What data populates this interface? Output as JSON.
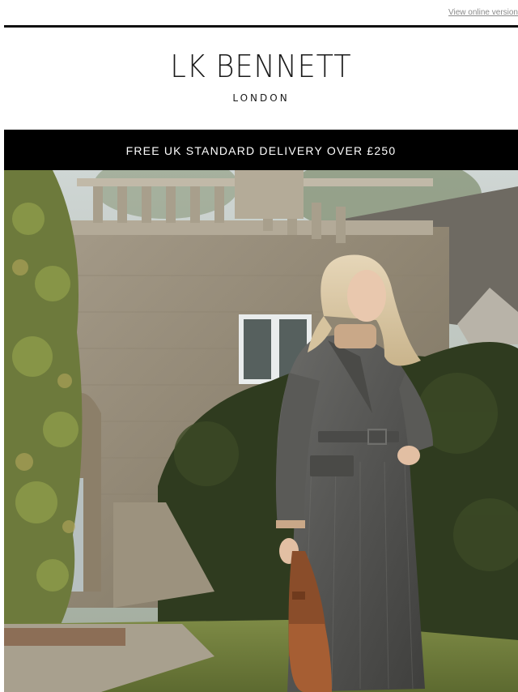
{
  "header": {
    "view_online_label": "View online version"
  },
  "brand": {
    "logo_text": "LK BENNETT",
    "logo_subtext": "LONDON"
  },
  "banner": {
    "delivery_text": "FREE UK STANDARD DELIVERY OVER £250"
  },
  "colors": {
    "banner_bg": "#000000",
    "banner_text": "#ffffff",
    "rule": "#111111",
    "link": "#8a8a8a"
  }
}
